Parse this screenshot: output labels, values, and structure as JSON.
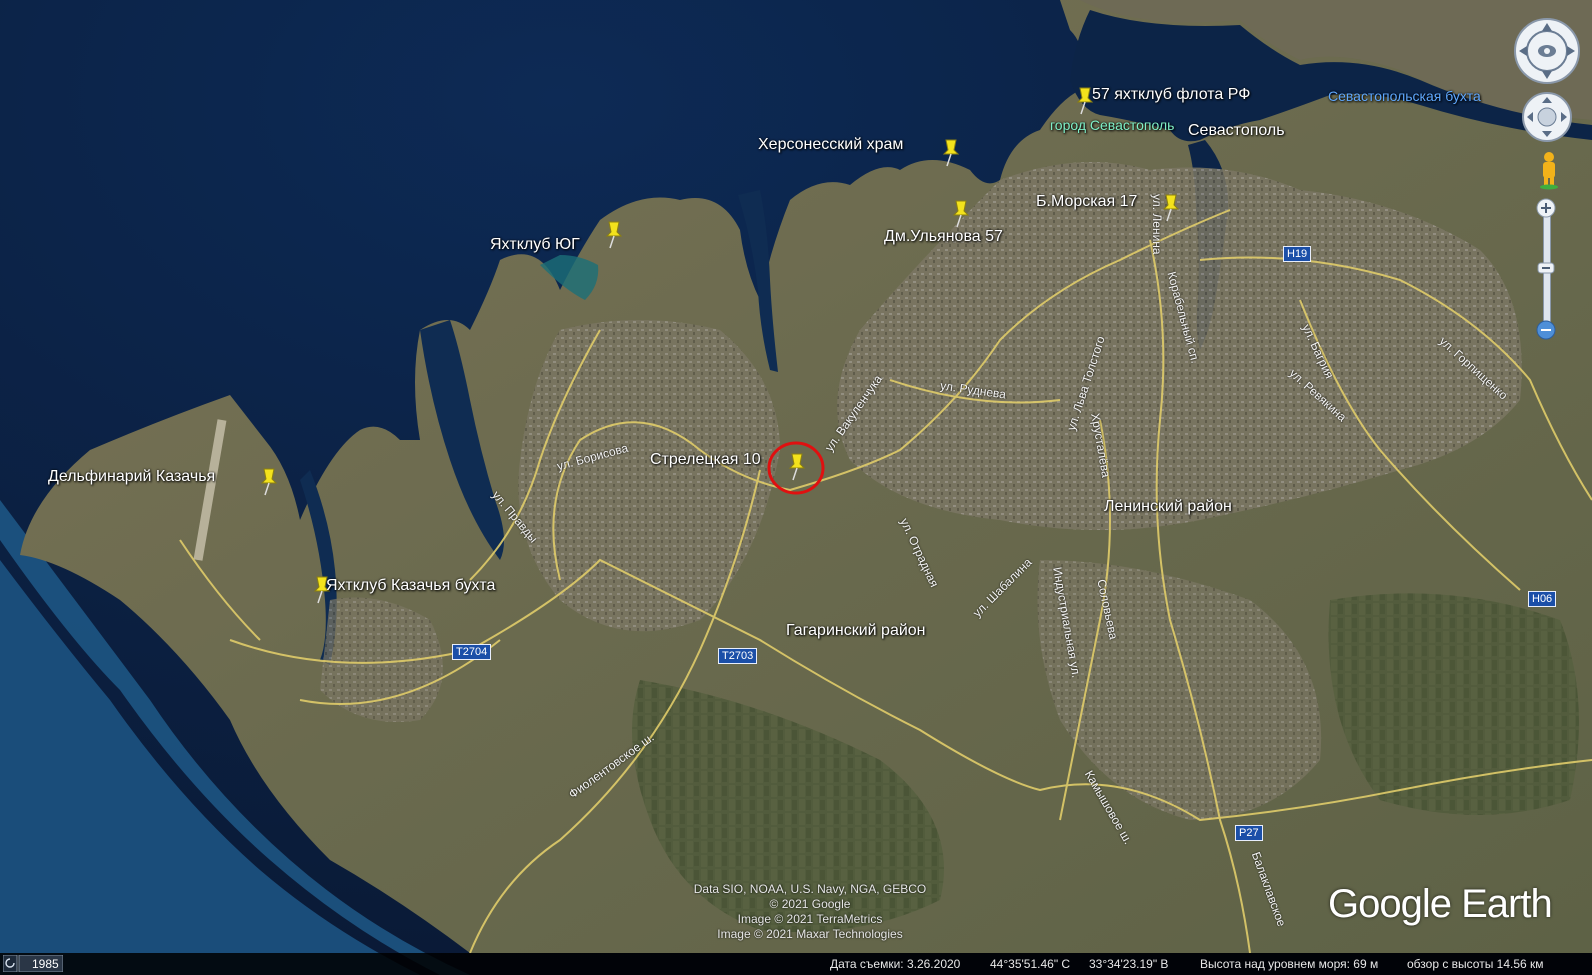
{
  "labels": {
    "yacht57": "57 яхтклуб флота РФ",
    "sevastopol_bay": "Севастопольская бухта",
    "city_sevastopol": "город Севастополь",
    "sevastopol": "Севастополь",
    "chersonese": "Херсонесский храм",
    "morskaya": "Б.Морская 17",
    "ulyanova": "Дм.Ульянова 57",
    "yacht_yug": "Яхтклуб ЮГ",
    "dolphinarium": "Дельфинарий Казачья",
    "yacht_kazachya": "Яхтклуб Казачья бухта",
    "streletskaya": "Стрелецкая 10",
    "leninsky": "Ленинский район",
    "gagarinsky": "Гагаринский район"
  },
  "streets": {
    "lenina": "ул. Ленина",
    "vakulenchuka": "ул. Вакуленчука",
    "rudneva": "ул. Руднева",
    "borisova": "ул. Борисова",
    "pravdy": "ул. Правды",
    "tolstogo": "ул. Льва Толстого",
    "khrustalyova": "Хрусталёва",
    "otradnaya": "ул. Отрадная",
    "shabalina": "ул. Шабалина",
    "industrialnaya": "Индустриальная ул.",
    "soloveva": "Соловьева",
    "bagriya": "ул. Багрия",
    "revyakina": "ул. Ревякина",
    "gorpishchenko": "ул. Горпищенко",
    "fiolentovskoe": "Фиолентовское ш.",
    "kamyshovoe": "Камышовое ш.",
    "balaklavskoe": "Балаклавское",
    "korabelny": "Корабельный сп."
  },
  "roads": {
    "h19": "H19",
    "h06": "H06",
    "t2704": "T2704",
    "t2703": "T2703",
    "p27": "P27"
  },
  "credits": {
    "line1": "Data SIO, NOAA, U.S. Navy, NGA, GEBCO",
    "line2": "© 2021 Google",
    "line3": "Image © 2021 TerraMetrics",
    "line4": "Image © 2021 Maxar Technologies"
  },
  "logo": "Google Earth",
  "statusbar": {
    "history_year": "1985",
    "capture_date": "Дата съемки: 3.26.2020",
    "lat": "44°35'51.46\" С",
    "lon": "33°34'23.19\" В",
    "elevation": "Высота над уровнем моря:   69 м",
    "eye_alt": "обзор с высоты   14.56 км"
  },
  "colors": {
    "sea_deep": "#0a1c3c",
    "land": "#6f6a4f",
    "road": "#e0cc6a",
    "pin": "#f3e21c",
    "highlight_circle": "#e01010",
    "route_shield": "#1b4fa8"
  },
  "icons": {
    "pins": "pushpin-icon",
    "look": "look-joystick-icon",
    "move": "move-joystick-icon",
    "pegman": "pegman-icon",
    "zoom_in": "zoom-in-icon",
    "zoom_out": "zoom-out-icon"
  }
}
